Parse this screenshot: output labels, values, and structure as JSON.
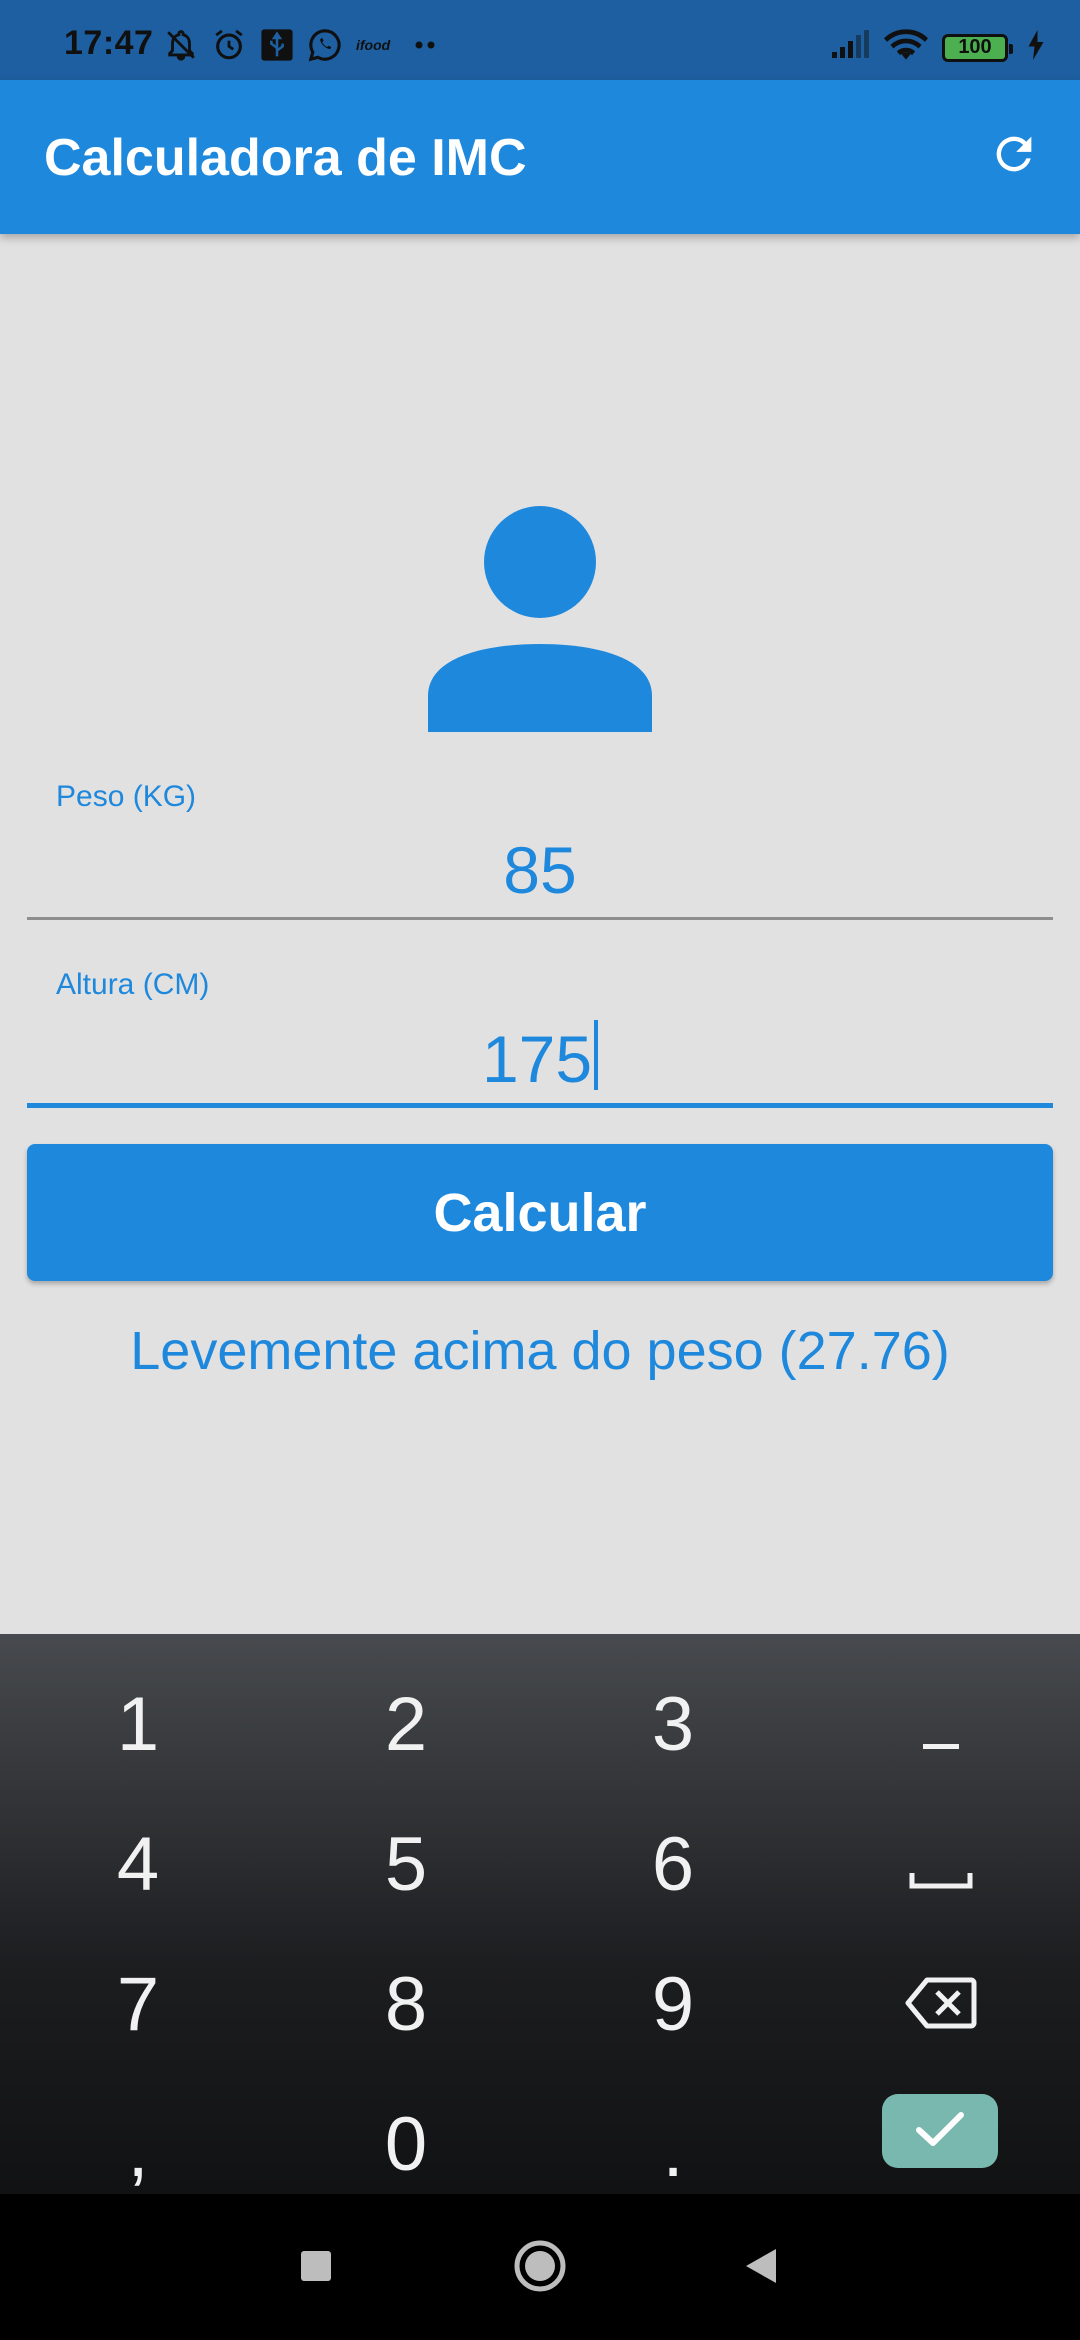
{
  "status_bar": {
    "time": "17:47",
    "battery": "100",
    "icons_left": [
      "muted-bell-icon",
      "alarm-icon",
      "usb-icon",
      "whatsapp-icon",
      "ifood-icon",
      "more-dots-icon"
    ],
    "icons_right": [
      "signal-icon",
      "wifi-icon",
      "battery-icon",
      "charging-icon"
    ]
  },
  "app_bar": {
    "title": "Calculadora de IMC",
    "action_icon": "refresh-icon"
  },
  "form": {
    "avatar_icon": "person-icon",
    "weight": {
      "label": "Peso (KG)",
      "value": "85"
    },
    "height": {
      "label": "Altura (CM)",
      "value": "175"
    },
    "button_label": "Calcular",
    "result": "Levemente acima do peso (27.76)"
  },
  "keyboard": {
    "rows": [
      [
        "1",
        "2",
        "3",
        "−"
      ],
      [
        "4",
        "5",
        "6",
        "␣"
      ],
      [
        "7",
        "8",
        "9",
        "⌫"
      ],
      [
        ",",
        "0",
        ".",
        "✓"
      ]
    ]
  },
  "nav_bar": {
    "icons": [
      "recents-icon",
      "home-icon",
      "back-icon"
    ]
  },
  "colors": {
    "primary": "#1e88dd",
    "status_bar": "#1d5fa0",
    "background": "#e1e1e1",
    "confirm_key": "#78b8ae"
  }
}
